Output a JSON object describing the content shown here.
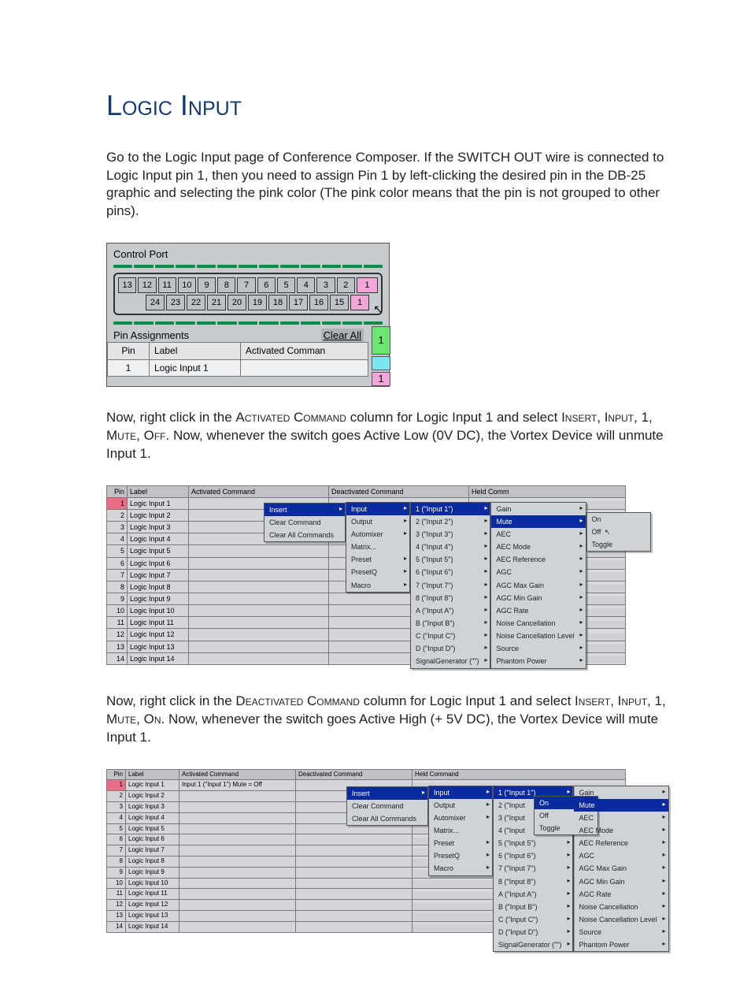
{
  "heading": "Logic Input",
  "para1": "Go to the Logic Input page of Conference Composer.  If the SWITCH OUT wire is connected to Logic Input pin 1, then you need to assign Pin 1 by left-clicking the desired pin in the DB-25 graphic and selecting the pink color (The pink color means that the pin is not grouped to other pins).",
  "para2_a": "Now, right click in the ",
  "para2_sc1": "Activated Command",
  "para2_b": " column for Logic Input 1 and select ",
  "para2_sc2": "Insert, Input, 1, Mute, Off",
  "para2_c": ".  Now, whenever the switch goes Active Low (0V DC), the Vortex Device will unmute Input 1.",
  "para3_a": "Now, right click in the ",
  "para3_sc1": "Deactivated Command",
  "para3_b": " column for Logic Input 1 and select ",
  "para3_sc2": "Insert, Input, 1, Mute, On",
  "para3_c": ".  Now, whenever the switch goes Active High (+ 5V DC), the Vortex Device will mute Input 1.",
  "cp": {
    "title": "Control Port",
    "pins_top": [
      "13",
      "12",
      "11",
      "10",
      "9",
      "8",
      "7",
      "6",
      "5",
      "4",
      "3",
      "2",
      "1"
    ],
    "pins_bottom": [
      "24",
      "23",
      "22",
      "21",
      "20",
      "19",
      "18",
      "17",
      "16",
      "15",
      "1"
    ],
    "pa_label": "Pin Assignments",
    "clear_all": "Clear All",
    "col_pin": "Pin",
    "col_label": "Label",
    "col_act": "Activated Comman",
    "row_pin": "1",
    "row_label": "Logic Input 1",
    "swatch_big": "1",
    "swatch_small": "1"
  },
  "grid_headers": {
    "pin": "Pin",
    "label": "Label",
    "act": "Activated Command",
    "deact": "Deactivated Command",
    "held": "Held Comm"
  },
  "grid2_rows": [
    {
      "n": "1",
      "l": "Logic Input 1"
    },
    {
      "n": "2",
      "l": "Logic Input 2"
    },
    {
      "n": "3",
      "l": "Logic Input 3"
    },
    {
      "n": "4",
      "l": "Logic Input 4"
    },
    {
      "n": "5",
      "l": "Logic Input 5"
    },
    {
      "n": "6",
      "l": "Logic Input 6"
    },
    {
      "n": "7",
      "l": "Logic Input 7"
    },
    {
      "n": "8",
      "l": "Logic Input 8"
    },
    {
      "n": "9",
      "l": "Logic Input 9"
    },
    {
      "n": "10",
      "l": "Logic Input 10"
    },
    {
      "n": "11",
      "l": "Logic Input 11"
    },
    {
      "n": "12",
      "l": "Logic Input 12"
    },
    {
      "n": "13",
      "l": "Logic Input 13"
    },
    {
      "n": "14",
      "l": "Logic Input 14"
    }
  ],
  "menus2": {
    "m1": [
      {
        "t": "Insert",
        "hl": true,
        "arr": true
      },
      {
        "t": "Clear Command"
      },
      {
        "t": "Clear All Commands"
      }
    ],
    "m2": [
      {
        "t": "Input",
        "hl": true,
        "arr": true
      },
      {
        "t": "Output",
        "arr": true
      },
      {
        "t": "Automixer",
        "arr": true
      },
      {
        "t": "Matrix..."
      },
      {
        "t": "Preset",
        "arr": true
      },
      {
        "t": "PresetQ",
        "arr": true
      },
      {
        "t": "Macro",
        "arr": true
      }
    ],
    "m3": [
      {
        "t": "1 (\"Input 1\")",
        "hl": true,
        "arr": true
      },
      {
        "t": "2 (\"Input 2\")",
        "arr": true
      },
      {
        "t": "3 (\"Input 3\")",
        "arr": true
      },
      {
        "t": "4 (\"Input 4\")",
        "arr": true
      },
      {
        "t": "5 (\"Input 5\")",
        "arr": true
      },
      {
        "t": "6 (\"Input 6\")",
        "arr": true
      },
      {
        "t": "7 (\"Input 7\")",
        "arr": true
      },
      {
        "t": "8 (\"Input 8\")",
        "arr": true
      },
      {
        "t": "A (\"Input A\")",
        "arr": true
      },
      {
        "t": "B (\"Input B\")",
        "arr": true
      },
      {
        "t": "C (\"Input C\")",
        "arr": true
      },
      {
        "t": "D (\"Input D\")",
        "arr": true
      },
      {
        "t": "SignalGenerator (\"\")",
        "arr": true
      }
    ],
    "m4": [
      {
        "t": "Gain",
        "arr": true
      },
      {
        "t": "Mute",
        "hl": true,
        "arr": true
      },
      {
        "t": "AEC",
        "arr": true
      },
      {
        "t": "AEC Mode",
        "arr": true
      },
      {
        "t": "AEC Reference",
        "arr": true
      },
      {
        "t": "AGC",
        "arr": true
      },
      {
        "t": "AGC Max Gain",
        "arr": true
      },
      {
        "t": "AGC Min Gain",
        "arr": true
      },
      {
        "t": "AGC Rate",
        "arr": true
      },
      {
        "t": "Noise Cancellation",
        "arr": true
      },
      {
        "t": "Noise Cancellation Level",
        "arr": true
      },
      {
        "t": "Source",
        "arr": true
      },
      {
        "t": "Phantom Power",
        "arr": true
      }
    ],
    "m5": [
      {
        "t": "On"
      },
      {
        "t": "Off",
        "cursor": true
      },
      {
        "t": "Toggle"
      }
    ]
  },
  "grid3_row1_act": "Input 1 (\"Input 1\") Mute = Off",
  "grid3_headers_held": "Held Command",
  "menus3": {
    "m1": [
      {
        "t": "Insert",
        "hl": true,
        "arr": true
      },
      {
        "t": "Clear Command"
      },
      {
        "t": "Clear All Commands"
      }
    ],
    "m2": [
      {
        "t": "Input",
        "hl": true,
        "arr": true
      },
      {
        "t": "Output",
        "arr": true
      },
      {
        "t": "Automixer",
        "arr": true
      },
      {
        "t": "Matrix..."
      },
      {
        "t": "Preset",
        "arr": true
      },
      {
        "t": "PresetQ",
        "arr": true
      },
      {
        "t": "Macro",
        "arr": true
      }
    ],
    "m3": [
      {
        "t": "1 (\"Input 1\")",
        "hl": true,
        "arr": true
      },
      {
        "t": "2 (\"Input",
        "arr": true
      },
      {
        "t": "3 (\"Input",
        "arr": true
      },
      {
        "t": "4 (\"Input",
        "arr": true
      },
      {
        "t": "5 (\"Input 5\")",
        "arr": true
      },
      {
        "t": "6 (\"Input 6\")",
        "arr": true
      },
      {
        "t": "7 (\"Input 7\")",
        "arr": true
      },
      {
        "t": "8 (\"Input 8\")",
        "arr": true
      },
      {
        "t": "A (\"Input A\")",
        "arr": true
      },
      {
        "t": "B (\"Input B\")",
        "arr": true
      },
      {
        "t": "C (\"Input C\")",
        "arr": true
      },
      {
        "t": "D (\"Input D\")",
        "arr": true
      },
      {
        "t": "SignalGenerator (\"\")",
        "arr": true
      }
    ],
    "m3b": [
      {
        "t": "On",
        "hl": true
      },
      {
        "t": "Off"
      },
      {
        "t": "Toggle"
      }
    ],
    "m4": [
      {
        "t": "Gain",
        "arr": true
      },
      {
        "t": "Mute",
        "hl": true,
        "arr": true
      },
      {
        "t": "AEC",
        "arr": true
      },
      {
        "t": "AEC Mode",
        "arr": true
      },
      {
        "t": "AEC Reference",
        "arr": true
      },
      {
        "t": "AGC",
        "arr": true
      },
      {
        "t": "AGC Max Gain",
        "arr": true
      },
      {
        "t": "AGC Min Gain",
        "arr": true
      },
      {
        "t": "AGC Rate",
        "arr": true
      },
      {
        "t": "Noise Cancellation",
        "arr": true
      },
      {
        "t": "Noise Cancellation Level",
        "arr": true
      },
      {
        "t": "Source",
        "arr": true
      },
      {
        "t": "Phantom Power",
        "arr": true
      }
    ]
  }
}
